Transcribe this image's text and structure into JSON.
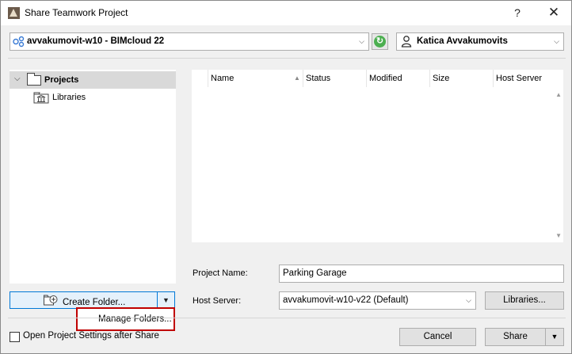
{
  "window": {
    "title": "Share Teamwork Project",
    "help_label": "?",
    "close_label": "✕"
  },
  "server_select": {
    "value": "avvakumovit-w10 - BIMcloud 22"
  },
  "user_select": {
    "value": "Katica Avvakumovits"
  },
  "tree": {
    "items": [
      {
        "label": "Projects"
      },
      {
        "label": "Libraries"
      }
    ]
  },
  "list": {
    "columns": [
      "Name",
      "Status",
      "Modified",
      "Size",
      "Host Server"
    ]
  },
  "form": {
    "project_name_label": "Project Name:",
    "project_name_value": "Parking Garage",
    "host_server_label": "Host Server:",
    "host_server_value": "avvakumovit-w10-v22 (Default)",
    "libraries_button": "Libraries..."
  },
  "create_folder": {
    "label": "Create Folder...",
    "menu_item": "Manage Folders..."
  },
  "footer": {
    "checkbox_label": "Open Project Settings after Share",
    "cancel_label": "Cancel",
    "share_label": "Share"
  },
  "colors": {
    "highlight_border": "#c00000",
    "focus_blue": "#0078d7",
    "refresh_green": "#4caf50"
  }
}
